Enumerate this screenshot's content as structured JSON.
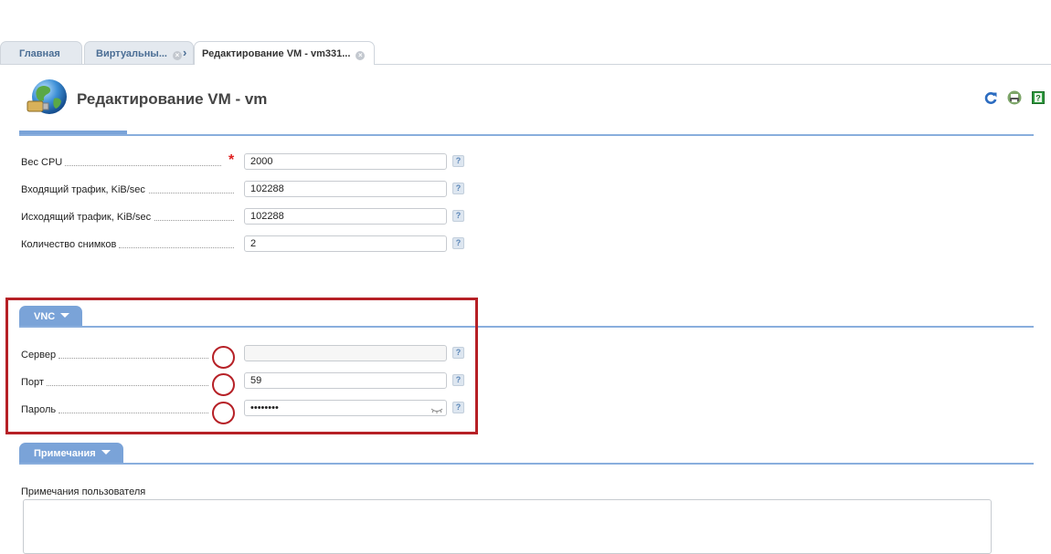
{
  "tabs": [
    {
      "label": "Главная",
      "closable": false
    },
    {
      "label": "Виртуальны...",
      "closable": true
    },
    {
      "label": "Редактирование VM - vm331...",
      "closable": true,
      "active": true
    }
  ],
  "header": {
    "title": "Редактирование VM - vm",
    "icon": "globe-plug-icon",
    "toolbar": [
      "refresh-icon",
      "print-icon",
      "help-book-icon"
    ]
  },
  "main_fields": [
    {
      "label": "Вес CPU",
      "value": "2000",
      "required": true
    },
    {
      "label": "Входящий трафик, KiB/sec",
      "value": "102288"
    },
    {
      "label": "Исходящий трафик, KiB/sec",
      "value": "102288"
    },
    {
      "label": "Количество снимков",
      "value": "2"
    }
  ],
  "vnc": {
    "tab_label": "VNC",
    "fields": [
      {
        "label": "Сервер",
        "value": "",
        "redacted": true
      },
      {
        "label": "Порт",
        "value": "59",
        "redacted": true
      },
      {
        "label": "Пароль",
        "value": "••••••••",
        "type": "password"
      }
    ]
  },
  "notes": {
    "tab_label": "Примечания",
    "label": "Примечания пользователя",
    "value": ""
  },
  "help_symbol": "?",
  "required_symbol": "*",
  "colors": {
    "accent": "#7aa3d8",
    "annotation": "#b62026",
    "required": "#e02020"
  }
}
